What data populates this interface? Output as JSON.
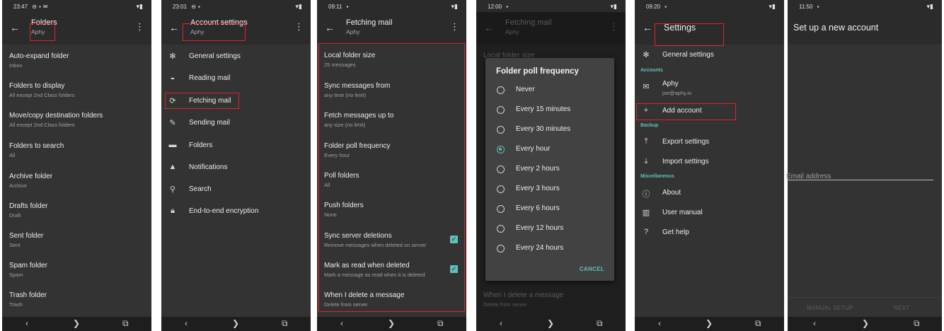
{
  "screens": [
    {
      "time": "23:47",
      "title": "Folders",
      "subtitle": "Aphy",
      "items": [
        {
          "title": "Auto-expand folder",
          "summary": "Inbox"
        },
        {
          "title": "Folders to display",
          "summary": "All except 2nd Class folders"
        },
        {
          "title": "Move/copy destination folders",
          "summary": "All except 2nd Class folders"
        },
        {
          "title": "Folders to search",
          "summary": "All"
        },
        {
          "title": "Archive folder",
          "summary": "Archive"
        },
        {
          "title": "Drafts folder",
          "summary": "Draft"
        },
        {
          "title": "Sent folder",
          "summary": "Sent"
        },
        {
          "title": "Spam folder",
          "summary": "Spam"
        },
        {
          "title": "Trash folder",
          "summary": "Trash"
        }
      ]
    },
    {
      "time": "23:01",
      "title": "Account settings",
      "subtitle": "Aphy",
      "items": [
        {
          "label": "General settings",
          "icon": "gear-icon"
        },
        {
          "label": "Reading mail",
          "icon": "envelope-open-icon"
        },
        {
          "label": "Fetching mail",
          "icon": "sync-icon"
        },
        {
          "label": "Sending mail",
          "icon": "pencil-icon"
        },
        {
          "label": "Folders",
          "icon": "folder-icon"
        },
        {
          "label": "Notifications",
          "icon": "bell-icon"
        },
        {
          "label": "Search",
          "icon": "search-icon"
        },
        {
          "label": "End-to-end encryption",
          "icon": "lock-icon"
        }
      ]
    },
    {
      "time": "09:11",
      "title": "Fetching mail",
      "subtitle": "Aphy",
      "items": [
        {
          "title": "Local folder size",
          "summary": "25 messages"
        },
        {
          "title": "Sync messages from",
          "summary": "any time (no limit)"
        },
        {
          "title": "Fetch messages up to",
          "summary": "any size (no limit)"
        },
        {
          "title": "Folder poll frequency",
          "summary": "Every hour"
        },
        {
          "title": "Poll folders",
          "summary": "All"
        },
        {
          "title": "Push folders",
          "summary": "None"
        },
        {
          "title": "Sync server deletions",
          "summary": "Remove messages when deleted on server",
          "checked": true
        },
        {
          "title": "Mark as read when deleted",
          "summary": "Mark a message as read when it is deleted",
          "checked": true
        },
        {
          "title": "When I delete a message",
          "summary": "Delete from server"
        }
      ]
    },
    {
      "time": "12:00",
      "title": "Fetching mail",
      "subtitle": "Aphy",
      "bg_items": [
        {
          "title": "Local folder size"
        },
        {
          "title": "When I delete a message",
          "summary": "Delete from server"
        }
      ],
      "dialog": {
        "title": "Folder poll frequency",
        "options": [
          "Never",
          "Every 15 minutes",
          "Every 30 minutes",
          "Every hour",
          "Every 2 hours",
          "Every 3 hours",
          "Every 6 hours",
          "Every 12 hours",
          "Every 24 hours"
        ],
        "selected": "Every hour",
        "cancel": "CANCEL"
      }
    },
    {
      "time": "09:20",
      "title": "Settings",
      "general": "General settings",
      "accounts_header": "Accounts",
      "account_name": "Aphy",
      "account_email": "joe@aphy.io",
      "add_account": "Add account",
      "backup_header": "Backup",
      "export": "Export settings",
      "import": "Import settings",
      "misc_header": "Miscellaneous",
      "about": "About",
      "manual": "User manual",
      "help": "Get help"
    },
    {
      "time": "11:50",
      "title": "Set up a new account",
      "email_placeholder": "Email address",
      "manual_setup": "MANUAL SETUP",
      "next": "NEXT"
    }
  ],
  "colors": {
    "accent": "#5fc0b8",
    "highlight": "#e02424",
    "background": "#333333",
    "appbar": "#2b2b2b"
  }
}
